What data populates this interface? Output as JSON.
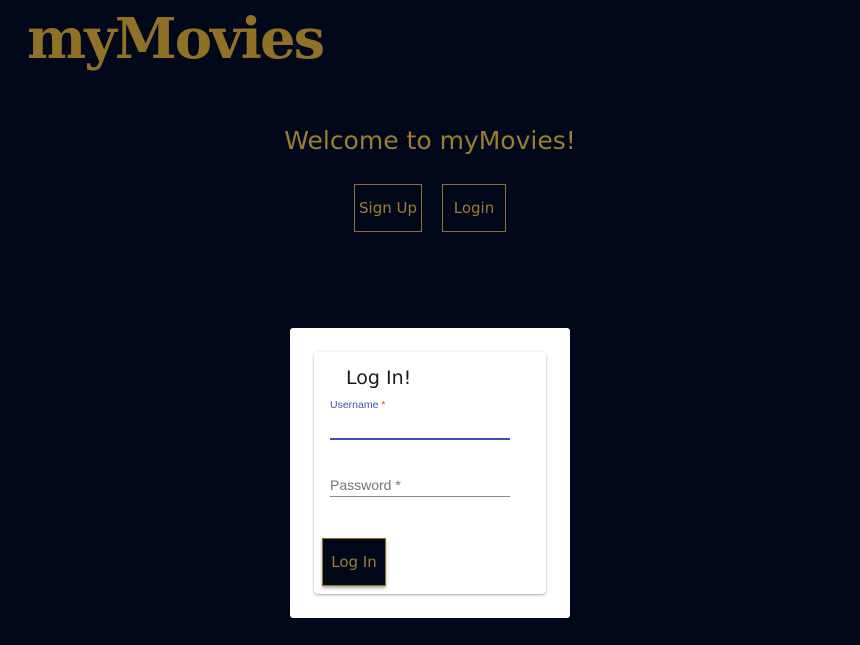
{
  "header": {
    "logo_text": "myMovies"
  },
  "hero": {
    "welcome_text": "Welcome to myMovies!"
  },
  "nav": {
    "signup_label": "Sign Up",
    "login_label": "Login"
  },
  "login_form": {
    "title": "Log In!",
    "username_label": "Username",
    "username_required_mark": "*",
    "username_value": "",
    "password_placeholder": "Password *",
    "submit_label": "Log In"
  },
  "colors": {
    "background": "#01081a",
    "gold": "#8f7128",
    "gold_text": "#9c7d30",
    "focus_blue": "#3f51b5",
    "required_red": "#e53935"
  }
}
